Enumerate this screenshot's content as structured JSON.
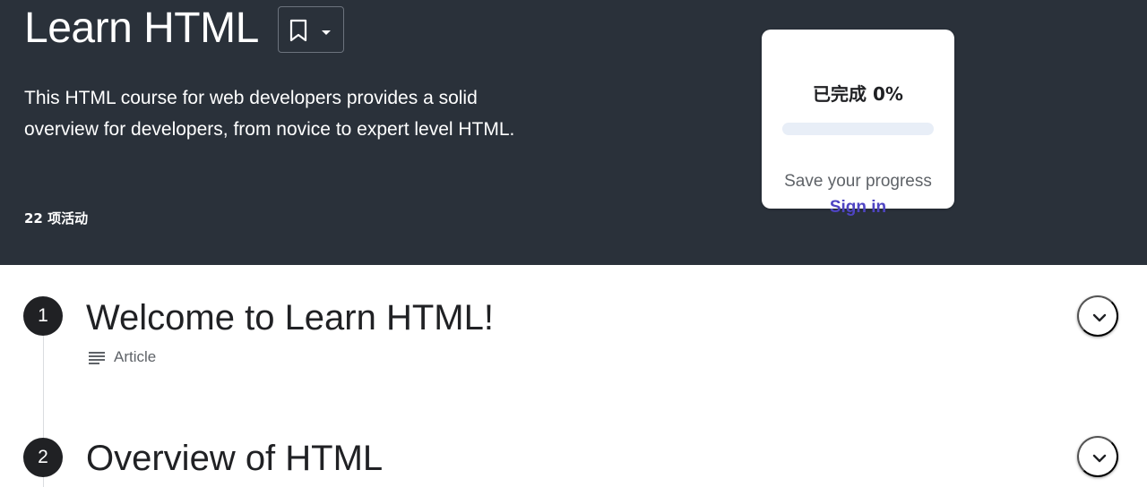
{
  "course": {
    "title": "Learn HTML",
    "description": "This HTML course for web developers provides a solid overview for developers, from novice to expert level HTML.",
    "activity_count": "22 项活动"
  },
  "bookmark": {
    "icon": "bookmark-icon",
    "dropdown_icon": "caret-down-icon"
  },
  "progress": {
    "label": "已完成 0%",
    "percent": 0,
    "save_text": "Save your progress",
    "sign_in_label": "Sign in"
  },
  "steps": [
    {
      "number": "1",
      "title": "Welcome to Learn HTML!",
      "type_label": "Article",
      "type_icon": "article-icon"
    },
    {
      "number": "2",
      "title": "Overview of HTML"
    }
  ],
  "colors": {
    "hero_background": "#2a313a",
    "accent": "#4e44c2",
    "progress_track": "#e8eef7"
  }
}
